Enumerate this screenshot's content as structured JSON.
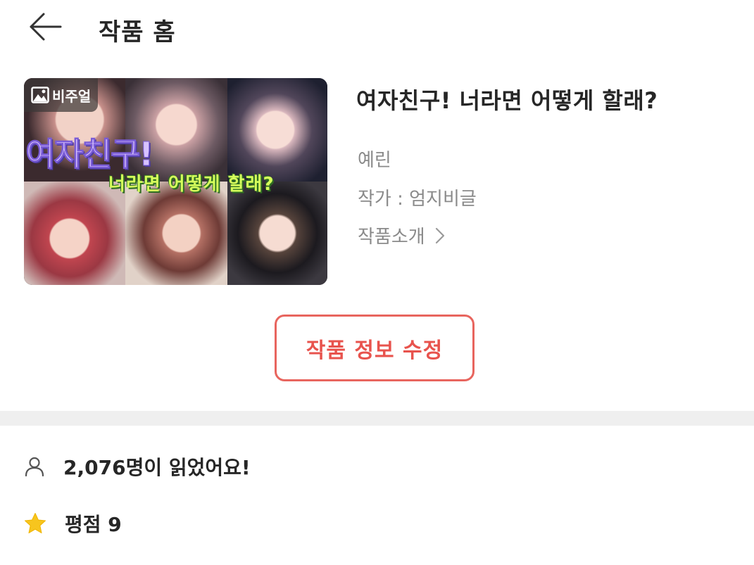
{
  "header": {
    "back_icon": "arrow-left-icon",
    "title": "작품 홈"
  },
  "cover": {
    "badge_icon": "image-icon",
    "badge_label": "비주얼",
    "art_title_line1": "여자친구!",
    "art_title_line2": "너라면 어떻게 할래?"
  },
  "work": {
    "title": "여자친구! 너라면 어떻게 할래?",
    "member": "예린",
    "author": "작가 : 엄지비글",
    "intro_link": "작품소개",
    "intro_icon": "chevron-right-icon"
  },
  "actions": {
    "edit_label": "작품 정보 수정"
  },
  "stats": {
    "readers_icon": "person-icon",
    "readers_text": "2,076명이 읽었어요!",
    "rating_icon": "star-icon",
    "rating_text": "평점 9"
  },
  "colors": {
    "accent": "#e8534d",
    "star": "#f7c51e",
    "muted_text": "#8a8a8a",
    "divider": "#efefef"
  }
}
